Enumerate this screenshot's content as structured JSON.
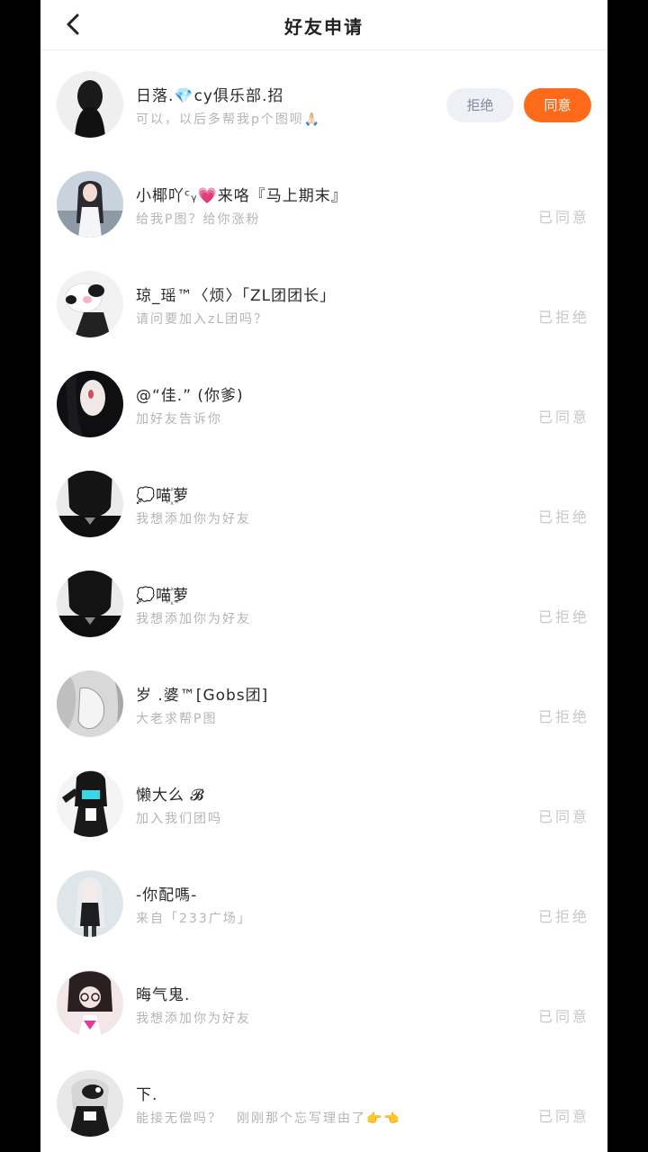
{
  "header": {
    "title": "好友申请",
    "back_icon": "chevron-left-icon"
  },
  "requests": [
    {
      "name": "日落.💎cy俱乐部.招",
      "message": "可以，以后多帮我p个图呗🙏🏻",
      "status": "",
      "actions": {
        "reject": "拒绝",
        "accept": "同意"
      }
    },
    {
      "name": "小椰吖ᶜᵧ💗来咯『马上期末』",
      "message": "给我P图？给你涨粉",
      "status": "已同意"
    },
    {
      "name": "琼_瑶™〈烦〉「ZL团团长」",
      "message": "请问要加入zL团吗？",
      "status": "已拒绝"
    },
    {
      "name": "@“佳.” (你爹)",
      "message": "加好友告诉你",
      "status": "已同意"
    },
    {
      "name": "💭喵꙰萝",
      "message": "我想添加你为好友",
      "status": "已拒绝"
    },
    {
      "name": "💭喵꙰萝",
      "message": "我想添加你为好友",
      "status": "已拒绝"
    },
    {
      "name": "岁 .婆™[Gobs团]",
      "message": "大老求帮P图",
      "status": "已拒绝"
    },
    {
      "name": "懒大么 𝓑",
      "message": "加入我们团吗",
      "status": "已同意"
    },
    {
      "name": "-你配嗎-",
      "message": "来自「233广场」",
      "status": "已拒绝"
    },
    {
      "name": "晦气鬼.",
      "message": "我想添加你为好友",
      "status": "已同意"
    },
    {
      "name": "下.",
      "message": "能接无偿吗？　刚刚那个忘写理由了👉👈",
      "status": "已同意"
    }
  ],
  "colors": {
    "accept_button": "#ff6a1a",
    "reject_button": "#eef0f5",
    "status_text": "#c8c8c8"
  }
}
